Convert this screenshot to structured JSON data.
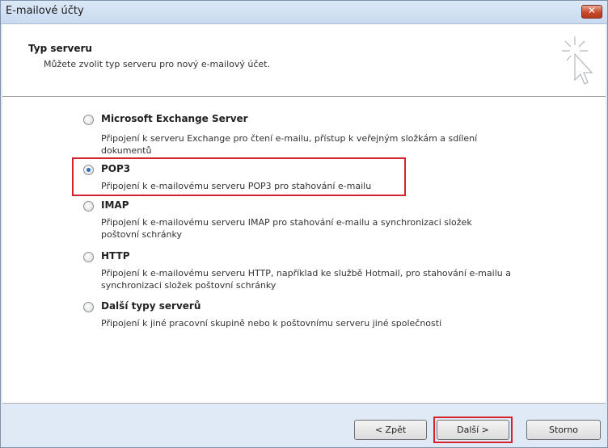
{
  "window": {
    "title": "E-mailové účty",
    "close_glyph": "✕"
  },
  "header": {
    "title": "Typ serveru",
    "subtitle": "Můžete zvolit typ serveru pro nový e-mailový účet.",
    "icon": "pointer-cursor-icon"
  },
  "options": [
    {
      "label": "Microsoft Exchange Server",
      "selected": false,
      "description": "Připojení k serveru Exchange pro čtení e-mailu, přístup k veřejným složkám a sdílení dokumentů"
    },
    {
      "label": "POP3",
      "selected": true,
      "description": "Připojení k e-mailovému serveru POP3 pro stahování e-mailu"
    },
    {
      "label": "IMAP",
      "selected": false,
      "description": "Připojení k e-mailovému serveru IMAP pro stahování e-mailu a synchronizaci složek poštovní schránky"
    },
    {
      "label": "HTTP",
      "selected": false,
      "description": "Připojení k e-mailovému serveru HTTP, například ke službě Hotmail, pro stahování e-mailu a synchronizaci složek poštovní schránky"
    },
    {
      "label": "Další typy serverů",
      "selected": false,
      "description": "Připojení k jiné pracovní skupině nebo k poštovnímu serveru jiné společnosti"
    }
  ],
  "buttons": {
    "back": "< Zpět",
    "next": "Další >",
    "cancel": "Storno"
  },
  "colors": {
    "highlight": "#d6222a",
    "accent": "#2d6fb8"
  }
}
